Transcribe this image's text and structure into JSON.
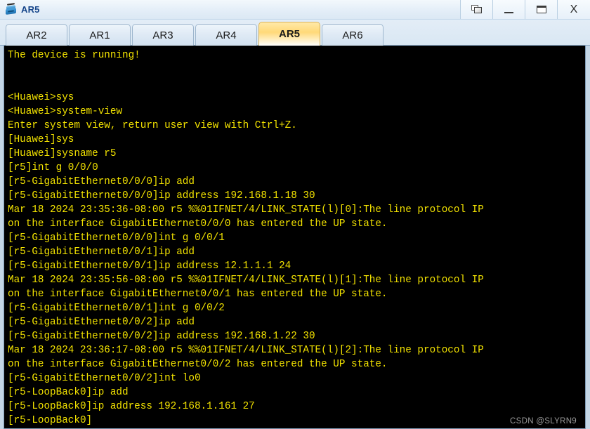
{
  "window": {
    "title": "AR5",
    "icon": "router-icon",
    "controls": [
      {
        "name": "restore-button",
        "icon": "restore-icon",
        "label": ""
      },
      {
        "name": "minimize-button",
        "icon": "minimize-icon",
        "label": ""
      },
      {
        "name": "maximize-button",
        "icon": "maximize-icon",
        "label": ""
      },
      {
        "name": "close-button",
        "icon": "close-icon",
        "label": "X"
      }
    ]
  },
  "tabs": [
    {
      "label": "AR2",
      "active": false
    },
    {
      "label": "AR1",
      "active": false
    },
    {
      "label": "AR3",
      "active": false
    },
    {
      "label": "AR4",
      "active": false
    },
    {
      "label": "AR5",
      "active": true
    },
    {
      "label": "AR6",
      "active": false
    }
  ],
  "terminal": {
    "foreground_color": "#f2e200",
    "background_color": "#000000",
    "lines": [
      "The device is running!",
      "",
      "",
      "<Huawei>sys",
      "<Huawei>system-view",
      "Enter system view, return user view with Ctrl+Z.",
      "[Huawei]sys",
      "[Huawei]sysname r5",
      "[r5]int g 0/0/0",
      "[r5-GigabitEthernet0/0/0]ip add",
      "[r5-GigabitEthernet0/0/0]ip address 192.168.1.18 30",
      "Mar 18 2024 23:35:36-08:00 r5 %%01IFNET/4/LINK_STATE(l)[0]:The line protocol IP",
      "on the interface GigabitEthernet0/0/0 has entered the UP state.",
      "[r5-GigabitEthernet0/0/0]int g 0/0/1",
      "[r5-GigabitEthernet0/0/1]ip add",
      "[r5-GigabitEthernet0/0/1]ip address 12.1.1.1 24",
      "Mar 18 2024 23:35:56-08:00 r5 %%01IFNET/4/LINK_STATE(l)[1]:The line protocol IP",
      "on the interface GigabitEthernet0/0/1 has entered the UP state.",
      "[r5-GigabitEthernet0/0/1]int g 0/0/2",
      "[r5-GigabitEthernet0/0/2]ip add",
      "[r5-GigabitEthernet0/0/2]ip address 192.168.1.22 30",
      "Mar 18 2024 23:36:17-08:00 r5 %%01IFNET/4/LINK_STATE(l)[2]:The line protocol IP",
      "on the interface GigabitEthernet0/0/2 has entered the UP state.",
      "[r5-GigabitEthernet0/0/2]int lo0",
      "[r5-LoopBack0]ip add",
      "[r5-LoopBack0]ip address 192.168.1.161 27",
      "[r5-LoopBack0]"
    ]
  },
  "watermark": {
    "text": "CSDN @SLYRN9",
    "color": "#9a9a9a"
  }
}
